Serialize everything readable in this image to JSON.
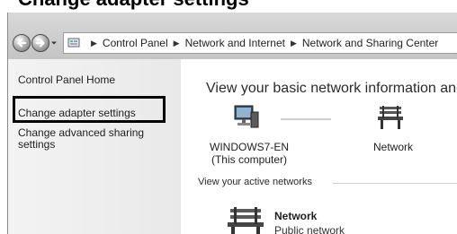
{
  "caption": {
    "text": "Change adapter settings"
  },
  "address_bar": {
    "crumbs": [
      "Control Panel",
      "Network and Internet",
      "Network and Sharing Center"
    ]
  },
  "left_pane": {
    "home": "Control Panel Home",
    "adapter": "Change adapter settings",
    "advanced": "Change advanced sharing settings"
  },
  "main": {
    "title": "View your basic network information and set up connections",
    "computer_name": "WINDOWS7-EN",
    "computer_sub": "(This computer)",
    "network_label": "Network",
    "active_networks_label": "View your active networks",
    "active_network": {
      "name": "Network",
      "type": "Public network"
    }
  },
  "icons": {
    "back": "back-arrow-icon",
    "forward": "forward-arrow-icon",
    "recent": "chevron-down-icon",
    "address": "control-panel-icon",
    "computer": "computer-icon",
    "network": "bench-icon"
  }
}
